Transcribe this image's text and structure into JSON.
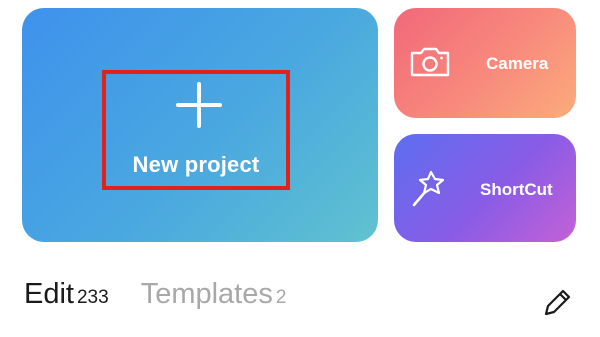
{
  "cards": {
    "new_project": {
      "label": "New project",
      "icon": "plus-icon"
    },
    "camera": {
      "label": "Camera",
      "icon": "camera-icon"
    },
    "shortcut": {
      "label": "ShortCut",
      "icon": "magic-wand-icon"
    }
  },
  "tabs": [
    {
      "label": "Edit",
      "count": "233",
      "active": true
    },
    {
      "label": "Templates",
      "count": "2",
      "active": false
    }
  ],
  "toolbar": {
    "edit_icon": "pencil-icon"
  },
  "colors": {
    "highlight": "#e0221b",
    "new_project_gradient": [
      "#3e92ec",
      "#60c2cf"
    ],
    "camera_gradient": [
      "#f2687a",
      "#fbac7b"
    ],
    "shortcut_gradient": [
      "#5c6ef0",
      "#c461d6"
    ],
    "active_tab": "#1a1a1a",
    "inactive_tab": "#a8a8a8"
  }
}
